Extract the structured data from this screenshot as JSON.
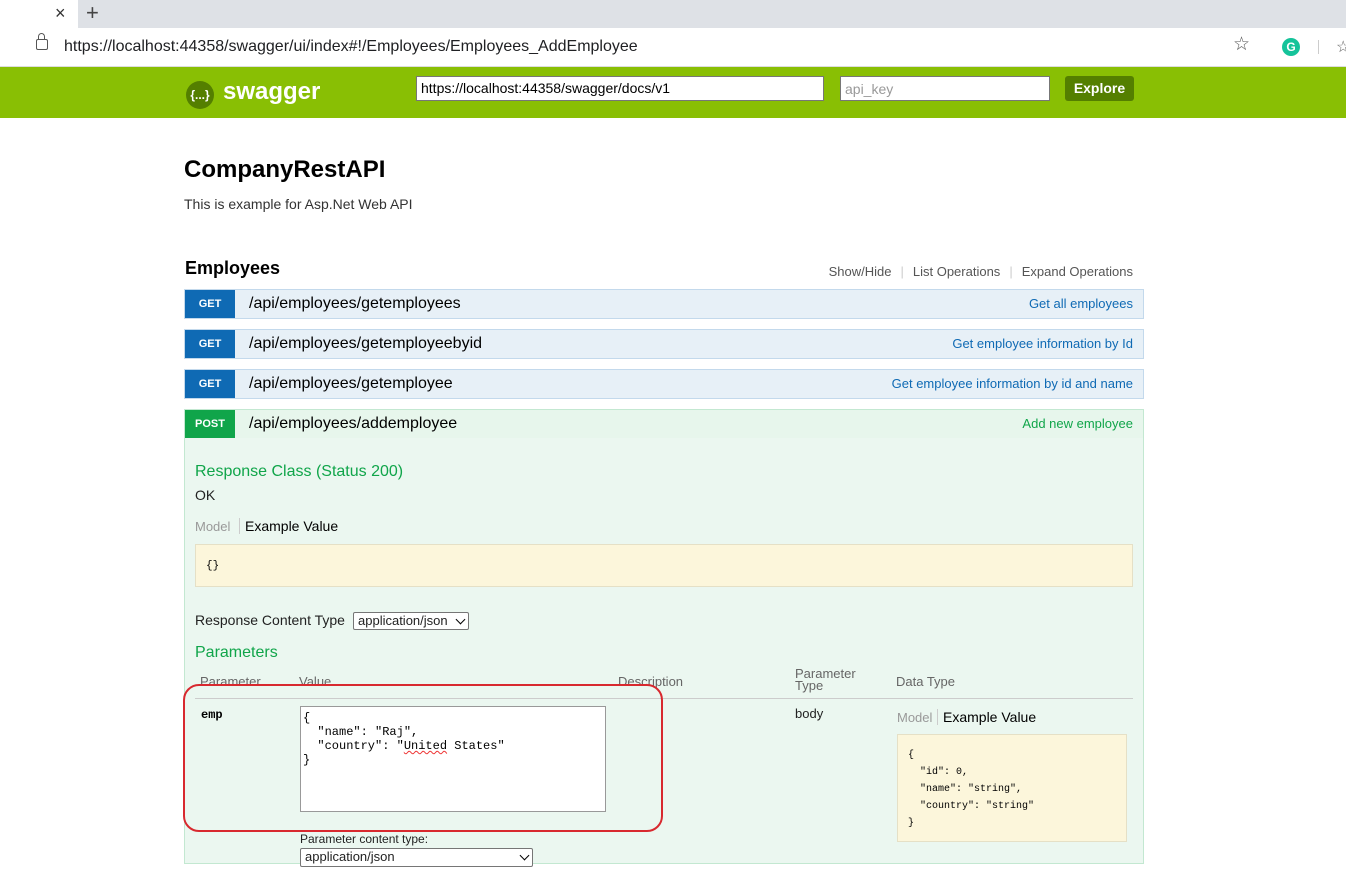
{
  "browser": {
    "tab_close": "×",
    "new_tab": "+",
    "url": "https://localhost:44358/swagger/ui/index#!/Employees/Employees_AddEmployee",
    "extension_badge": "G"
  },
  "header": {
    "logo_glyph": "{...}",
    "logo_text": "swagger",
    "spec_url": "https://localhost:44358/swagger/docs/v1",
    "api_key_placeholder": "api_key",
    "explore_label": "Explore",
    "bg_color": "#89bf04"
  },
  "info": {
    "title": "CompanyRestAPI",
    "description": "This is example for Asp.Net Web API"
  },
  "resource": {
    "name": "Employees",
    "links": [
      "Show/Hide",
      "List Operations",
      "Expand Operations"
    ]
  },
  "operations": [
    {
      "method": "GET",
      "path": "/api/employees/getemployees",
      "summary": "Get all employees"
    },
    {
      "method": "GET",
      "path": "/api/employees/getemployeebyid",
      "summary": "Get employee information by Id"
    },
    {
      "method": "GET",
      "path": "/api/employees/getemployee",
      "summary": "Get employee information by id and name"
    },
    {
      "method": "POST",
      "path": "/api/employees/addemployee",
      "summary": "Add new employee"
    }
  ],
  "expanded": {
    "response_class_heading": "Response Class (Status 200)",
    "response_class_value": "OK",
    "model_tab": "Model",
    "example_tab": "Example Value",
    "response_example": "{}",
    "response_content_type_label": "Response Content Type",
    "response_content_type": "application/json",
    "parameters_heading": "Parameters",
    "columns": [
      "Parameter",
      "Value",
      "Description",
      "Parameter\nType",
      "Data Type"
    ],
    "param": {
      "name": "emp",
      "value_line1": "{",
      "value_line2": "  \"name\": \"Raj\",",
      "value_line3_pre": "  \"country\": \"",
      "value_line3_word": "United",
      "value_line3_post": " States\"",
      "value_line4": "}",
      "type": "body",
      "model_tab": "Model",
      "example_tab": "Example Value",
      "example_schema": "{\n  \"id\": 0,\n  \"name\": \"string\",\n  \"country\": \"string\"\n}",
      "content_type_label": "Parameter content type:",
      "content_type": "application/json"
    }
  },
  "colors": {
    "get": "#0f6ab4",
    "post": "#10a54a",
    "highlight_ring": "#d8292f"
  }
}
